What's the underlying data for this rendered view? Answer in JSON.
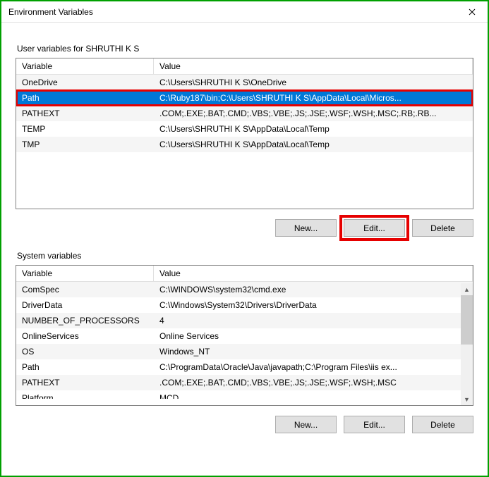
{
  "window": {
    "title": "Environment Variables"
  },
  "userSection": {
    "label": "User variables for SHRUTHI K S",
    "headers": {
      "variable": "Variable",
      "value": "Value"
    },
    "rows": [
      {
        "name": "OneDrive",
        "value": "C:\\Users\\SHRUTHI K S\\OneDrive",
        "selected": false
      },
      {
        "name": "Path",
        "value": "C:\\Ruby187\\bin;C:\\Users\\SHRUTHI K S\\AppData\\Local\\Micros...",
        "selected": true
      },
      {
        "name": "PATHEXT",
        "value": ".COM;.EXE;.BAT;.CMD;.VBS;.VBE;.JS;.JSE;.WSF;.WSH;.MSC;.RB;.RB...",
        "selected": false
      },
      {
        "name": "TEMP",
        "value": "C:\\Users\\SHRUTHI K S\\AppData\\Local\\Temp",
        "selected": false
      },
      {
        "name": "TMP",
        "value": "C:\\Users\\SHRUTHI K S\\AppData\\Local\\Temp",
        "selected": false
      }
    ],
    "buttons": {
      "new": "New...",
      "edit": "Edit...",
      "delete": "Delete"
    }
  },
  "systemSection": {
    "label": "System variables",
    "headers": {
      "variable": "Variable",
      "value": "Value"
    },
    "rows": [
      {
        "name": "ComSpec",
        "value": "C:\\WINDOWS\\system32\\cmd.exe"
      },
      {
        "name": "DriverData",
        "value": "C:\\Windows\\System32\\Drivers\\DriverData"
      },
      {
        "name": "NUMBER_OF_PROCESSORS",
        "value": "4"
      },
      {
        "name": "OnlineServices",
        "value": "Online Services"
      },
      {
        "name": "OS",
        "value": "Windows_NT"
      },
      {
        "name": "Path",
        "value": "C:\\ProgramData\\Oracle\\Java\\javapath;C:\\Program Files\\iis ex..."
      },
      {
        "name": "PATHEXT",
        "value": ".COM;.EXE;.BAT;.CMD;.VBS;.VBE;.JS;.JSE;.WSF;.WSH;.MSC"
      }
    ],
    "cutoff": {
      "name": "Platform",
      "value": "MCD"
    },
    "buttons": {
      "new": "New...",
      "edit": "Edit...",
      "delete": "Delete"
    }
  }
}
